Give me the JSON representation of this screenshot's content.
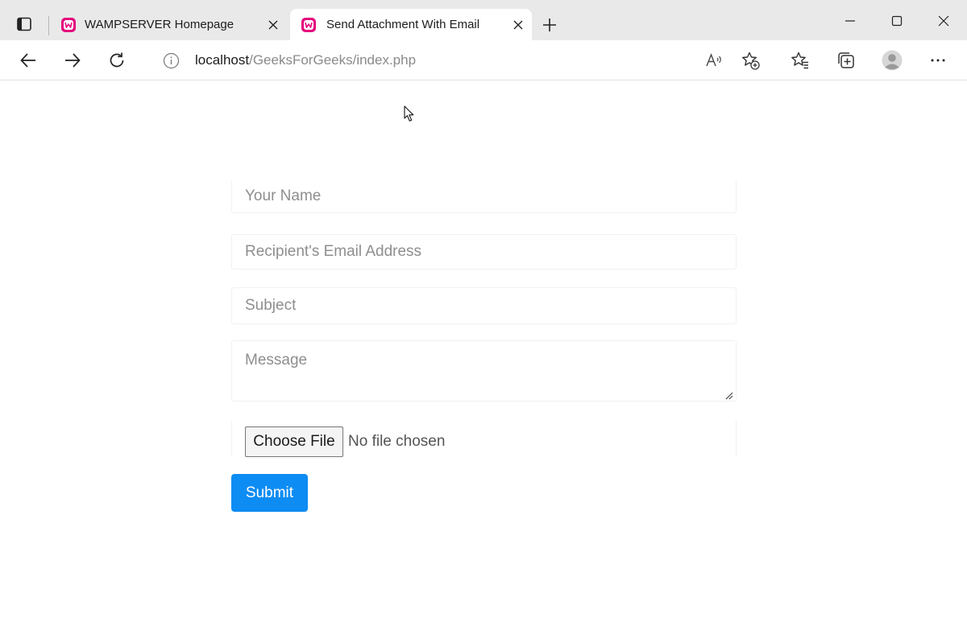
{
  "browser": {
    "tabs": [
      {
        "title": "WAMPSERVER Homepage",
        "favicon": "wampserver-icon",
        "active": false
      },
      {
        "title": "Send Attachment With Email",
        "favicon": "wampserver-icon",
        "active": true
      }
    ],
    "address_bar": {
      "host": "localhost",
      "path": "/GeeksForGeeks/index.php"
    },
    "favicon_color": "#e4007c",
    "icons": [
      "tab-actions-icon",
      "close-icon",
      "new-tab-icon",
      "minimize-icon",
      "maximize-icon",
      "window-close-icon",
      "back-arrow-icon",
      "forward-arrow-icon",
      "reload-icon",
      "site-info-icon",
      "read-aloud-icon",
      "add-favorite-icon",
      "favorites-icon",
      "collections-icon",
      "profile-icon",
      "more-icon"
    ]
  },
  "form": {
    "name_placeholder": "Your Name",
    "email_placeholder": "Recipient's Email Address",
    "subject_placeholder": "Subject",
    "message_placeholder": "Message",
    "file_button_label": "Choose File",
    "file_status": "No file chosen",
    "submit_label": "Submit",
    "submit_color": "#0d8cf3"
  }
}
